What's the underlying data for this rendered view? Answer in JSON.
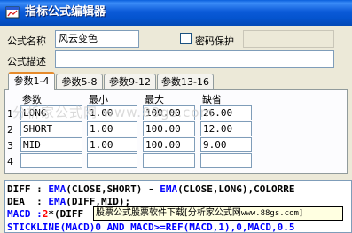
{
  "window": {
    "title": "指标公式编辑器",
    "icon": "window-app-icon"
  },
  "form": {
    "name_label": "公式名称",
    "name_value": "风云变色",
    "password_label": "密码保护",
    "password_checked": false,
    "password_value": "",
    "desc_label": "公式描述",
    "desc_value": ""
  },
  "tabs": [
    {
      "label": "参数1-4",
      "active": true
    },
    {
      "label": "参数5-8",
      "active": false
    },
    {
      "label": "参数9-12",
      "active": false
    },
    {
      "label": "参数13-16",
      "active": false
    }
  ],
  "params": {
    "headers": [
      "参数",
      "最小",
      "最大",
      "缺省"
    ],
    "rows": [
      {
        "num": "1",
        "name": "LONG",
        "min": "1.00",
        "max": "100.00",
        "def": "26.00"
      },
      {
        "num": "2",
        "name": "SHORT",
        "min": "1.00",
        "max": "100.00",
        "def": "12.00"
      },
      {
        "num": "3",
        "name": "MID",
        "min": "1.00",
        "max": "100.00",
        "def": "9.00"
      },
      {
        "num": "4",
        "name": "",
        "min": "",
        "max": "",
        "def": ""
      }
    ]
  },
  "watermark": "分析家公式网 www.88gs.com",
  "code": {
    "line1": {
      "a": "DIFF : ",
      "b": "EMA",
      "c": "(CLOSE,SHORT) - ",
      "d": "EMA",
      "e": "(CLOSE,LONG),COLORRE"
    },
    "line2": {
      "a": "DEA  : ",
      "b": "EMA",
      "c": "(DIFF,MID);"
    },
    "line3": {
      "a": "MACD :",
      "b": "2",
      "c": "*(DIFF"
    },
    "line4": {
      "a": "STICKLINE(MACD)0 AND MACD>=REF(MACD,1),0,MACD,0.5"
    }
  },
  "tooltip": {
    "text": "股票公式股票软件下载[分析家公式网",
    "site": "www.88gs.com]"
  },
  "colors": {
    "titlebar": "#0454cf",
    "keyword": "#0000ff",
    "number": "#ff0000",
    "tab_highlight": "#e68b2c",
    "tooltip_bg": "#ffffe1"
  }
}
